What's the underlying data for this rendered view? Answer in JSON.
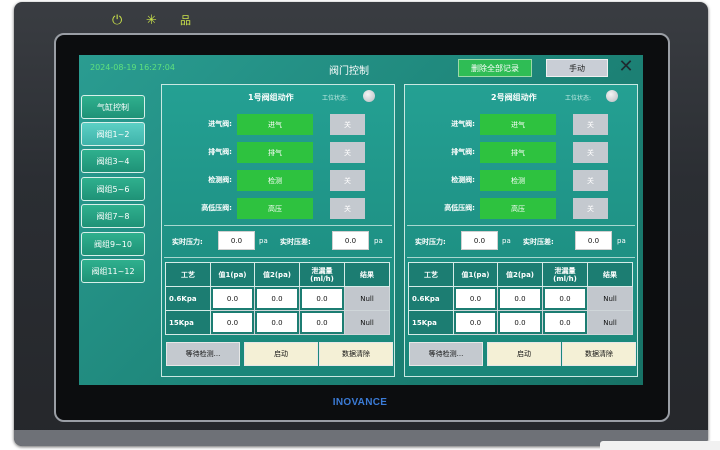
{
  "device": {
    "leds": [
      "⏻",
      "✳",
      "品"
    ],
    "brand": "INOVANCE"
  },
  "colors": {
    "screen_bg": "#1d8478",
    "active_green": "#2ec23f",
    "off_gray": "#c4c9cf",
    "datetime_green": "#5fe07d",
    "brand_blue": "#3b7bd6"
  },
  "header": {
    "datetime": "2024-08-19 16:27:04",
    "title": "阀门控制",
    "delete_all_label": "删除全部记录",
    "manual_label": "手动",
    "close_icon": "close-icon"
  },
  "sidebar": {
    "items": [
      {
        "label": "气缸控制",
        "active": false
      },
      {
        "label": "阀组1~2",
        "active": true
      },
      {
        "label": "阀组3~4",
        "active": false
      },
      {
        "label": "阀组5~6",
        "active": false
      },
      {
        "label": "阀组7~8",
        "active": false
      },
      {
        "label": "阀组9~10",
        "active": false
      },
      {
        "label": "阀组11~12",
        "active": false
      }
    ]
  },
  "groups": [
    {
      "title": "1号阀组动作",
      "work_status_label": "工位状态:",
      "valves": [
        {
          "label": "进气阀:",
          "on_label": "进气",
          "off_label": "关"
        },
        {
          "label": "排气阀:",
          "on_label": "排气",
          "off_label": "关"
        },
        {
          "label": "检测阀:",
          "on_label": "检测",
          "off_label": "关"
        },
        {
          "label": "高低压阀:",
          "on_label": "高压",
          "off_label": "关"
        }
      ],
      "pressure_label": "实时压力:",
      "pressure_value": "0.0",
      "pressure_unit": "pa",
      "diff_label": "实时压差:",
      "diff_value": "0.0",
      "diff_unit": "pa",
      "table": {
        "headers": [
          "工艺",
          "值1(pa)",
          "值2(pa)",
          "泄漏量\n(ml/h)",
          "结果"
        ],
        "rows": [
          {
            "label": "0.6Kpa",
            "v1": "0.0",
            "v2": "0.0",
            "leak": "0.0",
            "result": "Null"
          },
          {
            "label": "15Kpa",
            "v1": "0.0",
            "v2": "0.0",
            "leak": "0.0",
            "result": "Null"
          }
        ]
      },
      "actions": {
        "wait_label": "等待检测...",
        "start_label": "启动",
        "clear_label": "数据清除"
      }
    },
    {
      "title": "2号阀组动作",
      "work_status_label": "工位状态:",
      "valves": [
        {
          "label": "进气阀:",
          "on_label": "进气",
          "off_label": "关"
        },
        {
          "label": "排气阀:",
          "on_label": "排气",
          "off_label": "关"
        },
        {
          "label": "检测阀:",
          "on_label": "检测",
          "off_label": "关"
        },
        {
          "label": "高低压阀:",
          "on_label": "高压",
          "off_label": "关"
        }
      ],
      "pressure_label": "实时压力:",
      "pressure_value": "0.0",
      "pressure_unit": "pa",
      "diff_label": "实时压差:",
      "diff_value": "0.0",
      "diff_unit": "pa",
      "table": {
        "headers": [
          "工艺",
          "值1(pa)",
          "值2(pa)",
          "泄漏量\n(ml/h)",
          "结果"
        ],
        "rows": [
          {
            "label": "0.6Kpa",
            "v1": "0.0",
            "v2": "0.0",
            "leak": "0.0",
            "result": "Null"
          },
          {
            "label": "15Kpa",
            "v1": "0.0",
            "v2": "0.0",
            "leak": "0.0",
            "result": "Null"
          }
        ]
      },
      "actions": {
        "wait_label": "等待检测...",
        "start_label": "启动",
        "clear_label": "数据清除"
      }
    }
  ]
}
